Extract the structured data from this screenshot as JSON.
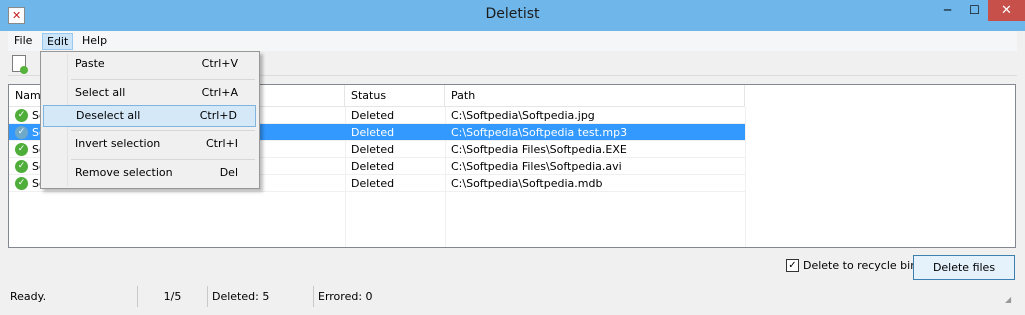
{
  "window": {
    "title": "Deletist",
    "minimize": "─",
    "maximize": "☐",
    "close": "✕"
  },
  "menubar": {
    "file": "File",
    "edit": "Edit",
    "help": "Help"
  },
  "edit_menu": {
    "items": [
      {
        "label": "Paste",
        "shortcut": "Ctrl+V"
      },
      {
        "label": "Select all",
        "shortcut": "Ctrl+A"
      },
      {
        "label": "Deselect all",
        "shortcut": "Ctrl+D"
      },
      {
        "label": "Invert selection",
        "shortcut": "Ctrl+I"
      },
      {
        "label": "Remove selection",
        "shortcut": "Del"
      }
    ],
    "highlighted_index": 2
  },
  "list": {
    "columns": [
      "Name",
      "Status",
      "Path"
    ],
    "rows": [
      {
        "name": "Sof",
        "status": "Deleted",
        "path": "C:\\Softpedia\\Softpedia.jpg",
        "selected": false
      },
      {
        "name": "Sof",
        "status": "Deleted",
        "path": "C:\\Softpedia\\Softpedia test.mp3",
        "selected": true
      },
      {
        "name": "So",
        "status": "Deleted",
        "path": "C:\\Softpedia Files\\Softpedia.EXE",
        "selected": false
      },
      {
        "name": "So",
        "status": "Deleted",
        "path": "C:\\Softpedia Files\\Softpedia.avi",
        "selected": false
      },
      {
        "name": "Softpedia.mdb",
        "status": "Deleted",
        "path": "C:\\Softpedia\\Softpedia.mdb",
        "selected": false
      }
    ]
  },
  "options": {
    "recycle_label": "Delete to recycle bin",
    "recycle_checked": true
  },
  "actions": {
    "delete_files": "Delete files"
  },
  "statusbar": {
    "state": "Ready.",
    "position": "1/5",
    "deleted": "Deleted: 5",
    "errored": "Errored: 0"
  },
  "colors": {
    "titlebar": "#6fb7ea",
    "selection": "#3399ff",
    "close_button": "#c7504b"
  }
}
